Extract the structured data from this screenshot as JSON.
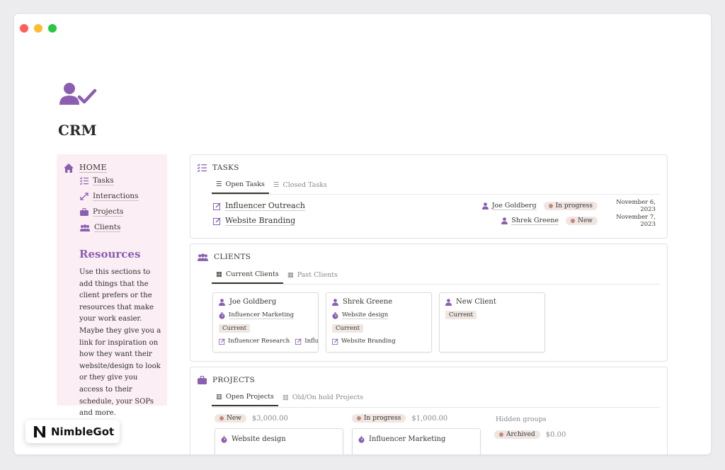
{
  "colors": {
    "accent": "#8b5fb0",
    "sidebar_bg": "#fbeef4",
    "badge_bg": "#efe6e2"
  },
  "page": {
    "title": "CRM",
    "icon": "user-check-icon"
  },
  "sidebar": {
    "home": "HOME",
    "items": [
      {
        "label": "Tasks",
        "icon": "task-list-icon"
      },
      {
        "label": "Interactions",
        "icon": "arrows-icon"
      },
      {
        "label": "Projects",
        "icon": "briefcase-icon"
      },
      {
        "label": "Clients",
        "icon": "group-icon"
      }
    ],
    "resources_title": "Resources",
    "resources_text": "Use this sections to add things that the client prefers or the resources that make your work easier. Maybe they give you a link for inspiration on how they want their website/design to look or they give you access to their schedule, your SOPs and more."
  },
  "tasks": {
    "title": "TASKS",
    "tabs": [
      "Open Tasks",
      "Closed Tasks"
    ],
    "rows": [
      {
        "name": "Influencer Outreach",
        "person": "Joe Goldberg",
        "status": "In progress",
        "date": "November 6, 2023"
      },
      {
        "name": "Website Branding",
        "person": "Shrek Greene",
        "status": "New",
        "date": "November 7, 2023"
      }
    ]
  },
  "clients": {
    "title": "CLIENTS",
    "tabs": [
      "Current Clients",
      "Past Clients"
    ],
    "cards": [
      {
        "name": "Joe Goldberg",
        "service": "Influencer Marketing",
        "status": "Current",
        "links": [
          "Influencer Research",
          "Influencer"
        ]
      },
      {
        "name": "Shrek Greene",
        "service": "Website design",
        "status": "Current",
        "links": [
          "Website Branding"
        ]
      },
      {
        "name": "New Client",
        "status": "Current"
      }
    ]
  },
  "projects": {
    "title": "PROJECTS",
    "tabs": [
      "Open Projects",
      "Old/On hold Projects"
    ],
    "groups": [
      {
        "status": "New",
        "amount": "$3,000.00",
        "card": "Website design"
      },
      {
        "status": "In progress",
        "amount": "$1,000.00",
        "card": "Influencer Marketing"
      }
    ],
    "hidden_label": "Hidden groups",
    "hidden": {
      "status": "Archived",
      "amount": "$0.00"
    }
  },
  "brand": {
    "name": "NimbleGot"
  }
}
